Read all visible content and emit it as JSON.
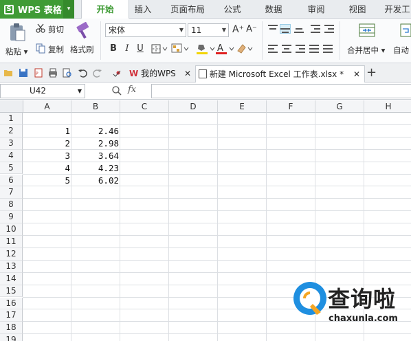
{
  "app": {
    "title": "WPS 表格",
    "logo_letter": "S",
    "caret": "▾"
  },
  "menu": {
    "tabs": [
      {
        "label": "开始",
        "active": true
      },
      {
        "label": "插入"
      },
      {
        "label": "页面布局"
      },
      {
        "label": "公式"
      },
      {
        "label": "数据"
      },
      {
        "label": "审阅"
      },
      {
        "label": "视图"
      },
      {
        "label": "开发工"
      }
    ]
  },
  "ribbon": {
    "clipboard": {
      "paste_label": "粘贴",
      "cut_label": "剪切",
      "copy_label": "复制",
      "format_painter_label": "格式刷"
    },
    "font": {
      "name": "宋体",
      "size": "11",
      "bold": "B",
      "italic": "I",
      "underline": "U",
      "font_color_label": "A"
    },
    "merge_center_label": "合并居中",
    "auto_wrap_label": "自动"
  },
  "doc_tabs": [
    {
      "label": "我的WPS",
      "icon": "wps-logo-icon"
    },
    {
      "label": "新建 Microsoft Excel 工作表.xlsx *",
      "icon": "spreadsheet-icon",
      "active": true
    }
  ],
  "formula_bar": {
    "cell_ref": "U42",
    "fx_label": "fx",
    "formula": ""
  },
  "sheet": {
    "columns": [
      "A",
      "B",
      "C",
      "D",
      "E",
      "F",
      "G",
      "H"
    ],
    "rows": [
      "1",
      "2",
      "3",
      "4",
      "5",
      "6",
      "7",
      "8",
      "9",
      "10",
      "11",
      "12",
      "13",
      "14",
      "15",
      "16",
      "17",
      "18",
      "19"
    ],
    "cells": [
      {
        "row": 2,
        "col": "A",
        "value": "1"
      },
      {
        "row": 3,
        "col": "A",
        "value": "2"
      },
      {
        "row": 4,
        "col": "A",
        "value": "3"
      },
      {
        "row": 5,
        "col": "A",
        "value": "4"
      },
      {
        "row": 6,
        "col": "A",
        "value": "5"
      },
      {
        "row": 2,
        "col": "B",
        "value": "2.46"
      },
      {
        "row": 3,
        "col": "B",
        "value": "2.98"
      },
      {
        "row": 4,
        "col": "B",
        "value": "3.64"
      },
      {
        "row": 5,
        "col": "B",
        "value": "4.23"
      },
      {
        "row": 6,
        "col": "B",
        "value": "6.02"
      }
    ]
  },
  "watermark": {
    "brand": "查询啦",
    "url": "chaxunla.com"
  },
  "colors": {
    "brand_green": "#3f9b35",
    "watermark_blue": "#1f8fe0",
    "watermark_orange": "#f5a623"
  }
}
